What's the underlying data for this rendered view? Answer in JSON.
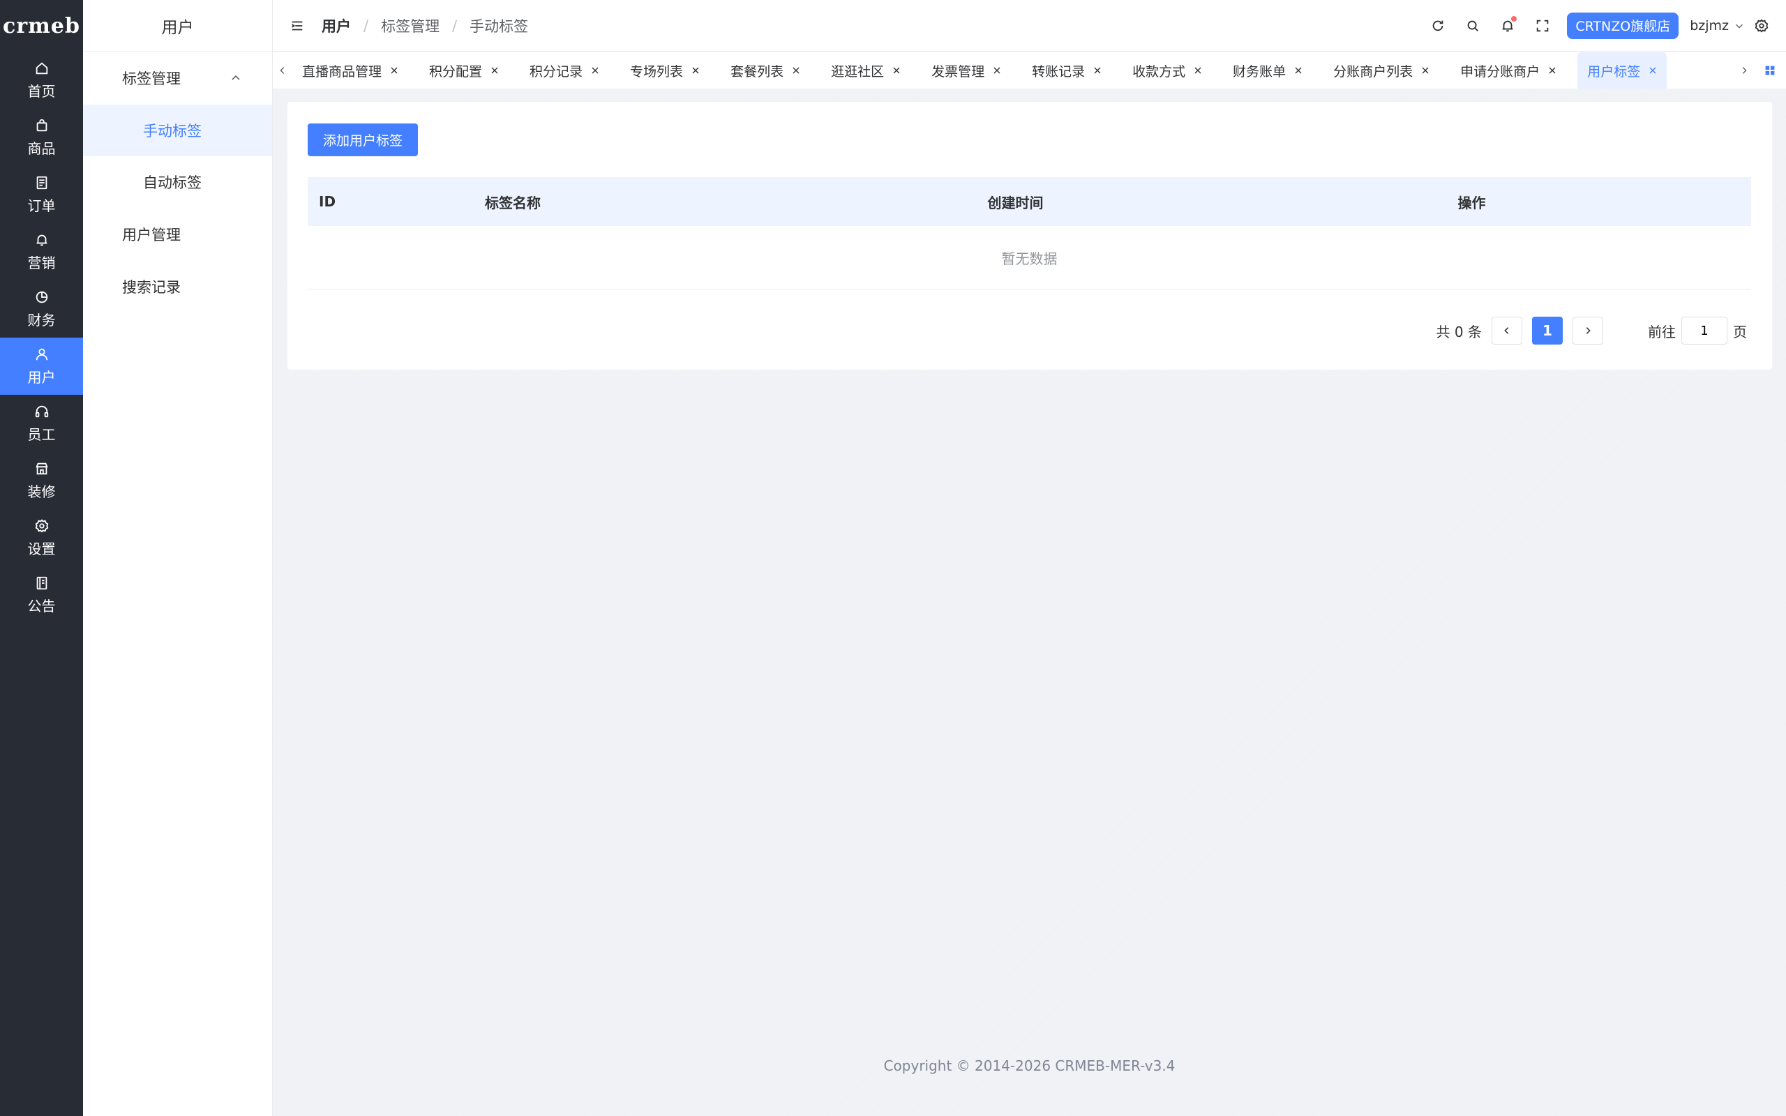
{
  "brand": {
    "logo_text": "crmeb"
  },
  "rail": {
    "items": [
      {
        "label": "首页",
        "icon": "home-icon"
      },
      {
        "label": "商品",
        "icon": "bag-icon"
      },
      {
        "label": "订单",
        "icon": "document-icon"
      },
      {
        "label": "营销",
        "icon": "bell-icon"
      },
      {
        "label": "财务",
        "icon": "pie-icon"
      },
      {
        "label": "用户",
        "icon": "user-icon",
        "active": true
      },
      {
        "label": "员工",
        "icon": "headset-icon"
      },
      {
        "label": "装修",
        "icon": "store-icon"
      },
      {
        "label": "设置",
        "icon": "gear-icon"
      },
      {
        "label": "公告",
        "icon": "notebook-icon"
      }
    ]
  },
  "submenu": {
    "title": "用户",
    "group": "标签管理",
    "group_items": [
      "手动标签",
      "自动标签"
    ],
    "top_items": [
      "用户管理",
      "搜索记录"
    ]
  },
  "header": {
    "breadcrumb": [
      "用户",
      "标签管理",
      "手动标签"
    ],
    "store_button": "CRTNZO旗舰店",
    "username": "bzjmz"
  },
  "tabs": [
    "直播商品管理",
    "积分配置",
    "积分记录",
    "专场列表",
    "套餐列表",
    "逛逛社区",
    "发票管理",
    "转账记录",
    "收款方式",
    "财务账单",
    "分账商户列表",
    "申请分账商户",
    "用户标签"
  ],
  "main": {
    "add_button": "添加用户标签",
    "columns": {
      "id": "ID",
      "name": "标签名称",
      "created": "创建时间",
      "ops": "操作"
    },
    "empty_text": "暂无数据"
  },
  "pagination": {
    "total_text": "共 0 条",
    "current_page": "1",
    "goto_label": "前往",
    "goto_value": "1",
    "page_suffix": "页"
  },
  "footer": {
    "copyright": "Copyright © 2014-2026 CRMEB-MER-v3.4"
  },
  "colors": {
    "accent": "#437ffe",
    "rail_bg": "#282c34",
    "page_bg": "#f0f2f5"
  }
}
